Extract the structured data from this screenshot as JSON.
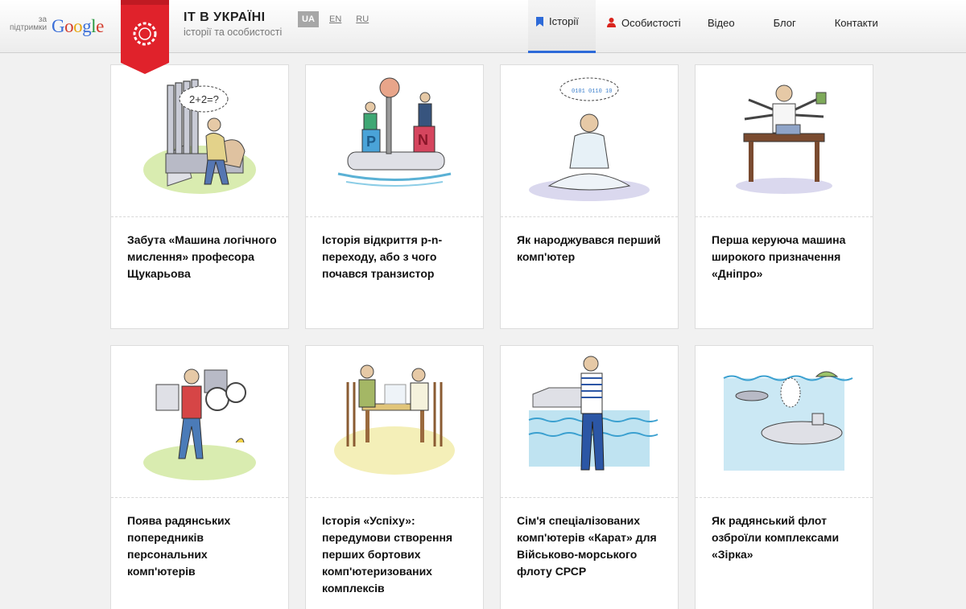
{
  "header": {
    "support_label_line1": "за",
    "support_label_line2": "підтримки",
    "google_logo_text": "Google",
    "site_title": "IT В УКРАЇНІ",
    "site_subtitle": "історії та особистості",
    "languages": [
      "UA",
      "EN",
      "RU"
    ],
    "active_language": "UA"
  },
  "nav": {
    "items": [
      {
        "label": "Історії",
        "icon": "bookmark-icon",
        "active": true
      },
      {
        "label": "Особистості",
        "icon": "person-icon",
        "active": false
      },
      {
        "label": "Відео",
        "active": false
      },
      {
        "label": "Блог",
        "active": false
      },
      {
        "label": "Контакти",
        "active": false
      }
    ]
  },
  "colors": {
    "accent_blue": "#2d6ad8",
    "ribbon_red": "#e0222b"
  },
  "cards": [
    {
      "title": "Забута «Машина логічного мислення» професора Щукарьова",
      "illustration": "thinking-machine-illustration",
      "thought_text": "2+2=?"
    },
    {
      "title": "Історія відкриття p-n-переходу, або з чого почався транзистор",
      "illustration": "pn-junction-illustration",
      "letters": [
        "P",
        "N"
      ]
    },
    {
      "title": "Як народжувався перший комп'ютер",
      "illustration": "meditating-man-illustration"
    },
    {
      "title": "Перша керуюча машина широкого призначення «Дніпро»",
      "illustration": "multi-armed-worker-illustration"
    },
    {
      "title": "Поява радянських попередників персональних комп'ютерів",
      "illustration": "portable-computer-man-illustration"
    },
    {
      "title": "Історія «Успіху»: передумови створення перших бортових комп'ютеризованих комплексів",
      "illustration": "chess-players-illustration"
    },
    {
      "title": "Сім'я спеціалізованих комп'ютерів «Карат» для Військово-морського флоту СРСР",
      "illustration": "sailor-illustration"
    },
    {
      "title": "Як радянський флот озброїли комплексами «Зірка»",
      "illustration": "submarine-illustration"
    }
  ]
}
